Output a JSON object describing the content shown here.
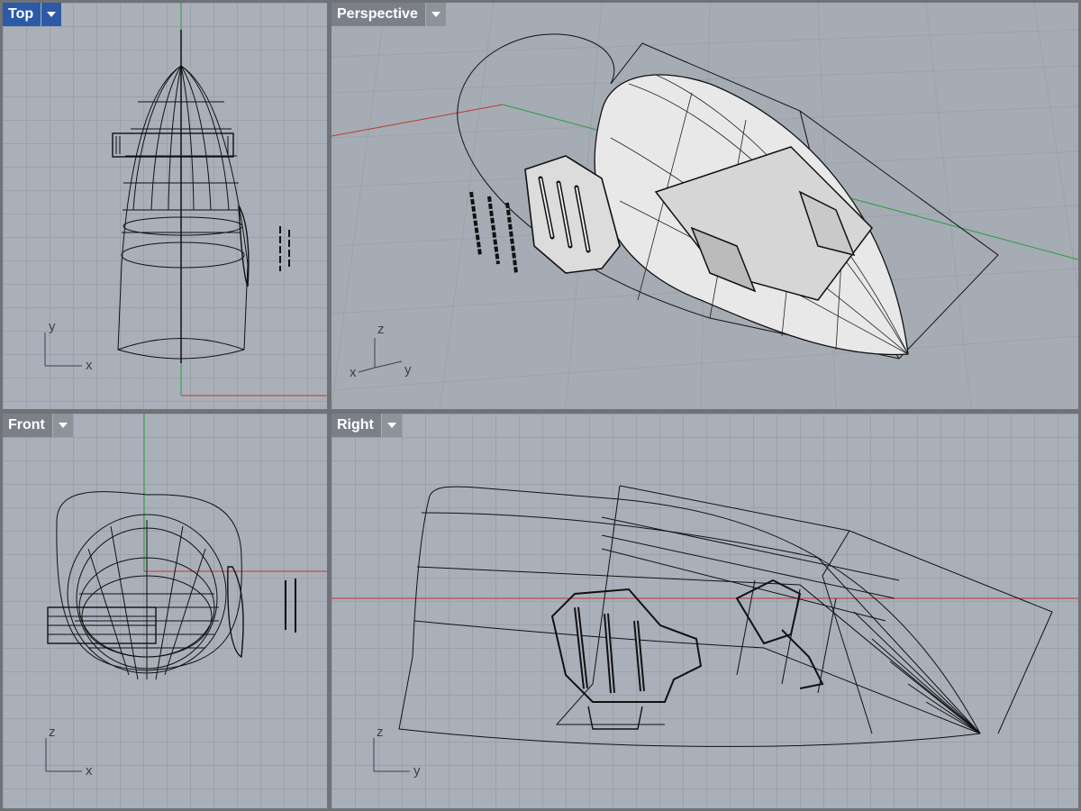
{
  "viewports": {
    "top": {
      "title": "Top",
      "axis_h": "x",
      "axis_v": "y",
      "active": true
    },
    "perspective": {
      "title": "Perspective",
      "axis_1": "x",
      "axis_2": "y",
      "axis_3": "z"
    },
    "front": {
      "title": "Front",
      "axis_h": "x",
      "axis_v": "z"
    },
    "right": {
      "title": "Right",
      "axis_h": "y",
      "axis_v": "z"
    }
  },
  "colors": {
    "viewport_bg": "#a9b0ba",
    "grid": "#9aa1ab",
    "active_tab": "#2d5aa6",
    "inactive_tab": "#7b8088",
    "x_axis": "#c0392b",
    "y_axis": "#2e9b3e",
    "wire": "#111111",
    "shaded_surface": "#e6e6e6"
  },
  "icons": {
    "viewport_menu": "chevron-down-icon"
  }
}
